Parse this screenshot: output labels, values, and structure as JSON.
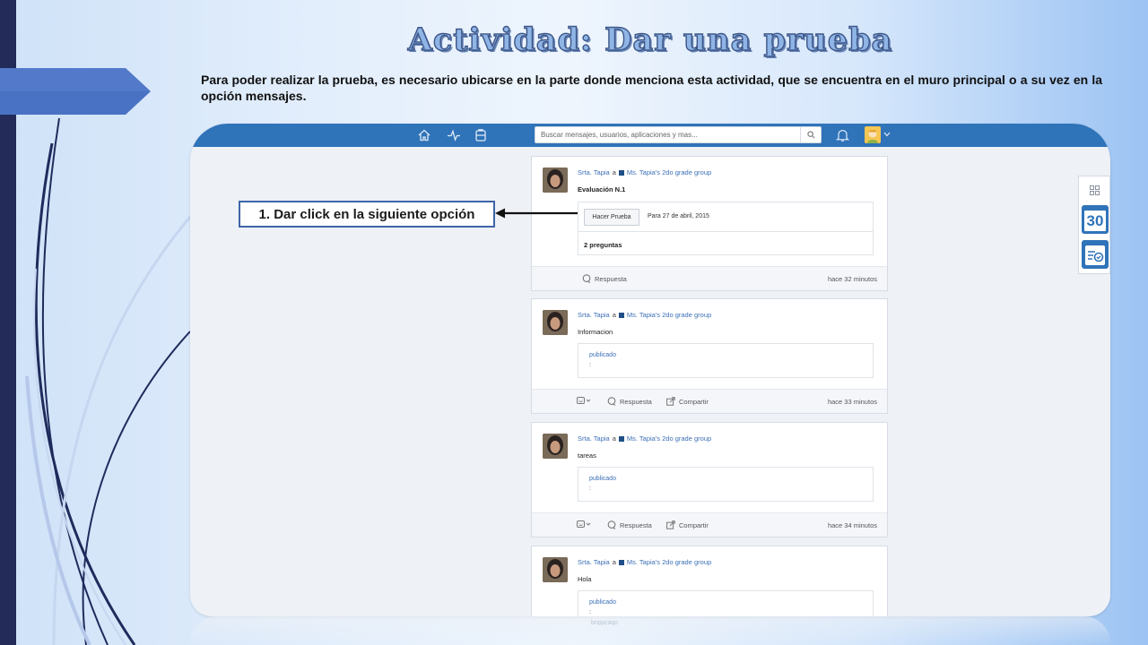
{
  "slide": {
    "title": "Actividad: Dar una prueba",
    "intro": "Para poder realizar la prueba, es necesario ubicarse en la parte donde menciona esta actividad, que se encuentra en el muro principal o a su vez en la opción mensajes."
  },
  "callout": {
    "label": "1. Dar click en la siguiente opción"
  },
  "app": {
    "nav": {
      "icons": [
        "home-icon",
        "activity-icon",
        "backpack-icon"
      ],
      "search_placeholder": "Buscar mensajes, usuarios, aplicaciones y mas...",
      "search_icon": "search-icon",
      "bell_icon": "bell-icon",
      "avatar_icon": "avatar-icon"
    },
    "sidetools": {
      "apps_icon": "apps-grid-icon",
      "calendar_number": "30",
      "checklist_icon": "checklist-icon"
    },
    "posts": [
      {
        "author": "Srta. Tapia",
        "to": "a",
        "group": "Ms. Tapia's 2do grade group",
        "title": "Evaluación N.1",
        "button": "Hacer Prueba",
        "due": "Para 27 de abril, 2015",
        "questions": "2 preguntas",
        "reply": "Respuesta",
        "time": "hace 32 minutos"
      },
      {
        "author": "Srta. Tapia",
        "to": "a",
        "group": "Ms. Tapia's 2do grade group",
        "title": "Informacion",
        "published": "publicado",
        "colon": ":",
        "reply": "Respuesta",
        "share": "Compartir",
        "time": "hace 33 minutos"
      },
      {
        "author": "Srta. Tapia",
        "to": "a",
        "group": "Ms. Tapia's 2do grade group",
        "title": "tareas",
        "published": "publicado",
        "colon": ":",
        "reply": "Respuesta",
        "share": "Compartir",
        "time": "hace 34 minutos"
      },
      {
        "author": "Srta. Tapia",
        "to": "a",
        "group": "Ms. Tapia's 2do grade group",
        "title": "Hola",
        "published": "publicado",
        "colon": ":"
      }
    ]
  },
  "colors": {
    "nav_blue": "#2f73b9",
    "link_blue": "#3b6fb6",
    "left_bar": "#232c58",
    "tab_blue": "#4a72c4",
    "callout_border": "#3e64a7"
  }
}
